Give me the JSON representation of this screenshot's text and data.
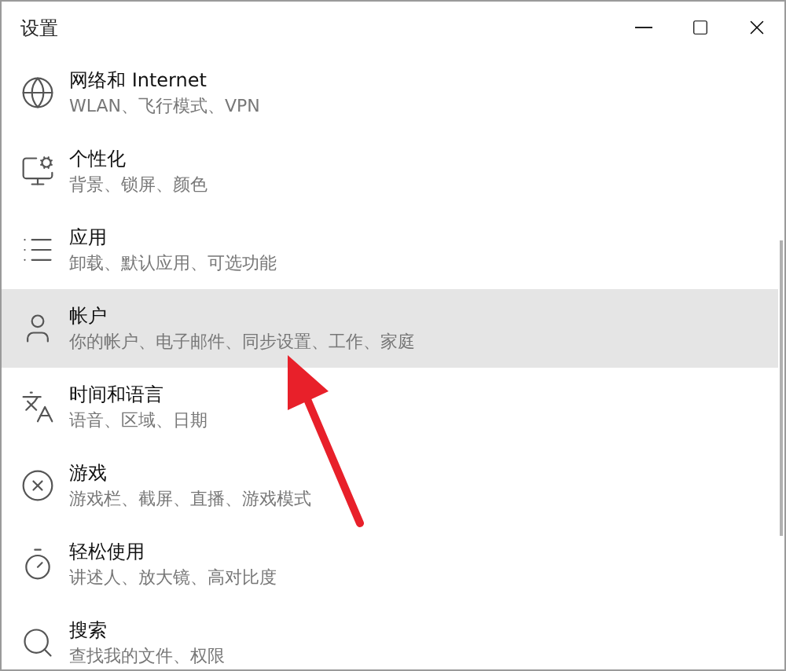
{
  "window": {
    "title": "设置"
  },
  "items": [
    {
      "title": "网络和 Internet",
      "subtitle": "WLAN、飞行模式、VPN",
      "selected": false
    },
    {
      "title": "个性化",
      "subtitle": "背景、锁屏、颜色",
      "selected": false
    },
    {
      "title": "应用",
      "subtitle": "卸载、默认应用、可选功能",
      "selected": false
    },
    {
      "title": "帐户",
      "subtitle": "你的帐户、电子邮件、同步设置、工作、家庭",
      "selected": true
    },
    {
      "title": "时间和语言",
      "subtitle": "语音、区域、日期",
      "selected": false
    },
    {
      "title": "游戏",
      "subtitle": "游戏栏、截屏、直播、游戏模式",
      "selected": false
    },
    {
      "title": "轻松使用",
      "subtitle": "讲述人、放大镜、高对比度",
      "selected": false
    },
    {
      "title": "搜索",
      "subtitle": "查找我的文件、权限",
      "selected": false
    }
  ]
}
